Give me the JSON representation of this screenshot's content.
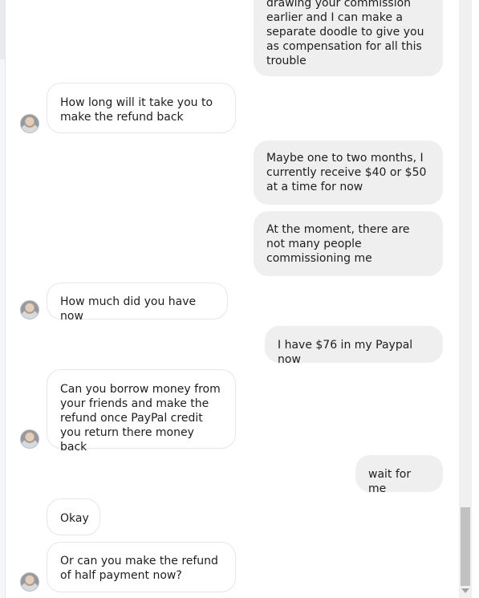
{
  "messages": [
    {
      "side": "out",
      "text": "drawing your commission earlier and I can make a separate doodle to give you as compensation for all this trouble"
    },
    {
      "side": "in",
      "text": "How long will it take you to make the refund back"
    },
    {
      "side": "out",
      "text": "Maybe one to two months, I currently receive $40 or $50 at a time for now"
    },
    {
      "side": "out",
      "text": "At the moment, there are not many people commissioning me"
    },
    {
      "side": "in",
      "text": "How much did you have now"
    },
    {
      "side": "out",
      "text": "I have $76 in my Paypal now"
    },
    {
      "side": "in",
      "text": "Can you borrow money from your friends and make the refund once PayPal credit you return there money back"
    },
    {
      "side": "out",
      "text": "wait for me"
    },
    {
      "side": "in",
      "text": "Okay"
    },
    {
      "side": "in",
      "text": "Or can you make the refund of half payment now?"
    }
  ],
  "avatar_icon": "user-avatar-photo",
  "colors": {
    "outgoing_bubble": "#efefef",
    "incoming_bubble": "#ffffff",
    "incoming_border": "#e6e6e6",
    "scrollbar": "#f0f0f0",
    "scroll_thumb": "#c1c1c1"
  }
}
